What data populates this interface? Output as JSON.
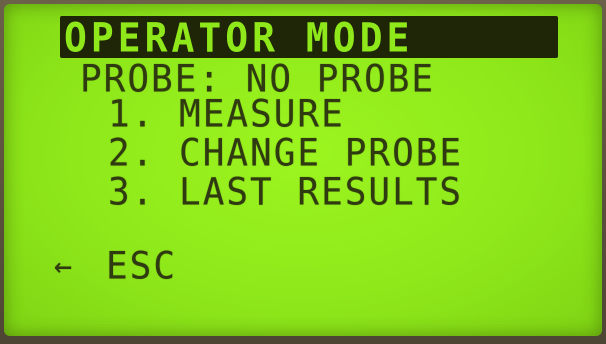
{
  "screen": {
    "title": "OPERATOR MODE",
    "probe_status": "PROBE: NO PROBE",
    "menu": [
      {
        "label": "1. MEASURE"
      },
      {
        "label": "2. CHANGE PROBE"
      },
      {
        "label": "3. LAST RESULTS"
      }
    ],
    "back": {
      "arrow": "←",
      "label": "ESC",
      "icon": "left-arrow-icon"
    }
  },
  "colors": {
    "lcd_background": "#8fe81a",
    "lcd_text": "#2f3a10",
    "title_bar": "#1f2608"
  }
}
